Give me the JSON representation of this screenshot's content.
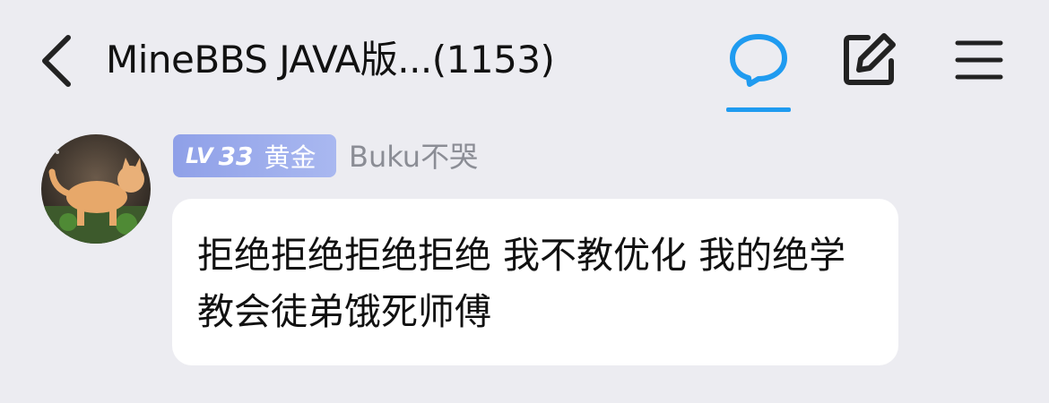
{
  "header": {
    "title": "MineBBS JAVA版...(1153)",
    "icons": {
      "back": "chevron-left-icon",
      "chat": "chat-bubble-icon",
      "edit": "edit-icon",
      "menu": "hamburger-menu-icon"
    },
    "active_tab_color": "#1f9bf0"
  },
  "message": {
    "avatar": "cat-avatar",
    "level_prefix": "LV",
    "level_number": "33",
    "rank": "黄金",
    "username": "Buku不哭",
    "text": "拒绝拒绝拒绝拒绝 我不教优化 我的绝学 教会徒弟饿死师傅"
  },
  "colors": {
    "background": "#ececf1",
    "bubble": "#ffffff",
    "badge": "#9aabeb",
    "username": "#8b8d95"
  }
}
